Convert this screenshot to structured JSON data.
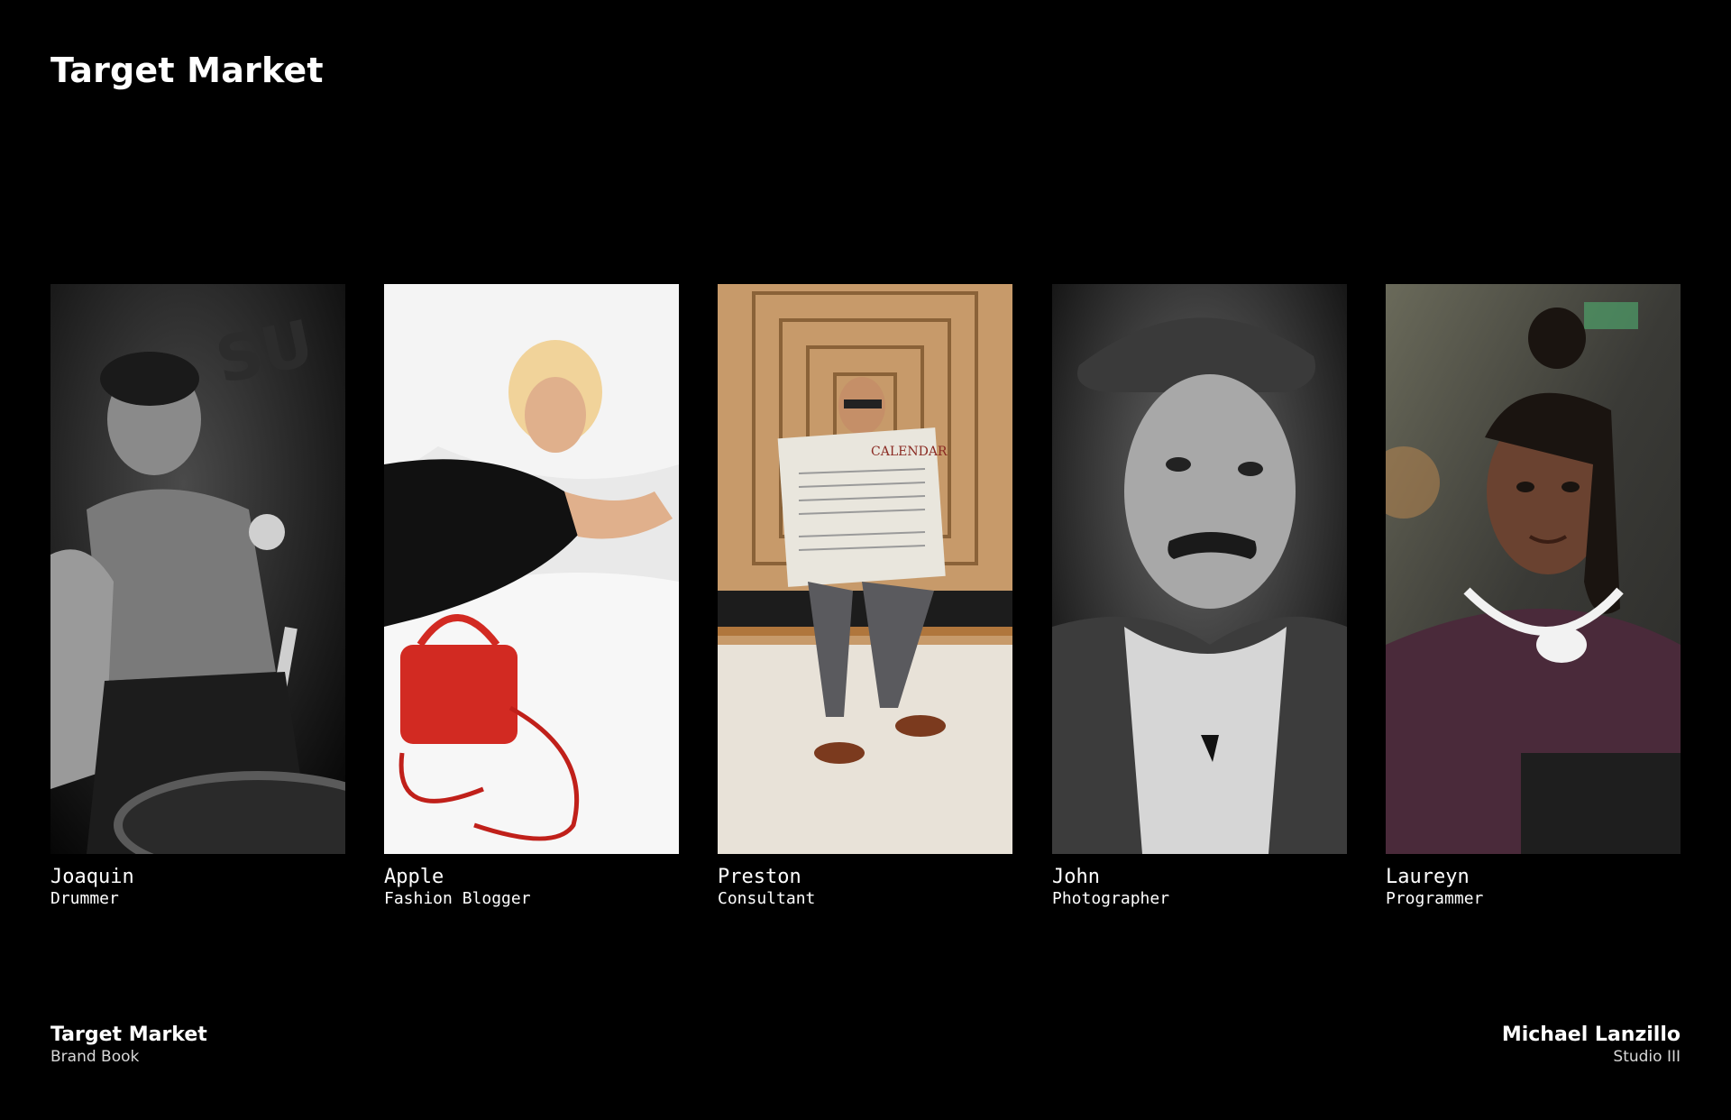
{
  "header": {
    "title": "Target Market"
  },
  "personas": [
    {
      "name": "Joaquin",
      "role": "Drummer",
      "photo": "photo-bw-drummer"
    },
    {
      "name": "Apple",
      "role": "Fashion Blogger",
      "photo": "photo-blogger-red-bag"
    },
    {
      "name": "Preston",
      "role": "Consultant",
      "photo": "photo-man-reading-newspaper"
    },
    {
      "name": "John",
      "role": "Photographer",
      "photo": "photo-bw-portrait-flat-cap"
    },
    {
      "name": "Laureyn",
      "role": "Programmer",
      "photo": "photo-woman-with-headphones"
    }
  ],
  "footer": {
    "left_title": "Target Market",
    "left_subtitle": "Brand Book",
    "right_title": "Michael Lanzillo",
    "right_subtitle": "Studio III"
  },
  "colors": {
    "background": "#000000",
    "text": "#ffffff"
  }
}
